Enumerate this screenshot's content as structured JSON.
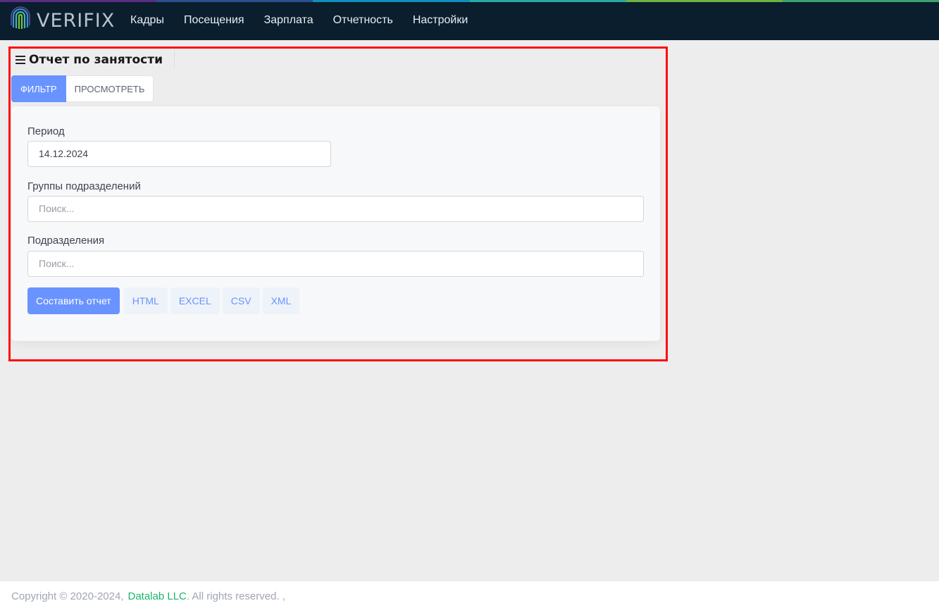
{
  "brand": {
    "name": "VERIFIX",
    "stripe_colors": [
      "#5b2c83",
      "#2b4f8f",
      "#0f8fbd",
      "#2ca6a4",
      "#6cb33f",
      "#3ea06b"
    ]
  },
  "nav": {
    "items": [
      {
        "label": "Кадры"
      },
      {
        "label": "Посещения"
      },
      {
        "label": "Зарплата"
      },
      {
        "label": "Отчетность"
      },
      {
        "label": "Настройки"
      }
    ]
  },
  "page": {
    "title": "Отчет по занятости",
    "highlight_color": "#ff0a0a"
  },
  "tabs": [
    {
      "label": "ФИЛЬТР",
      "active": true
    },
    {
      "label": "ПРОСМОТРЕТЬ",
      "active": false
    }
  ],
  "form": {
    "period": {
      "label": "Период",
      "value": "14.12.2024"
    },
    "division_groups": {
      "label": "Группы подразделений",
      "placeholder": "Поиск..."
    },
    "divisions": {
      "label": "Подразделения",
      "placeholder": "Поиск..."
    }
  },
  "actions": {
    "build_label": "Составить отчет",
    "formats": [
      "HTML",
      "EXCEL",
      "CSV",
      "XML"
    ]
  },
  "footer": {
    "copyright": "Copyright © 2020-2024,",
    "company": "Datalab LLC",
    "suffix": ". All rights reserved. ,"
  }
}
